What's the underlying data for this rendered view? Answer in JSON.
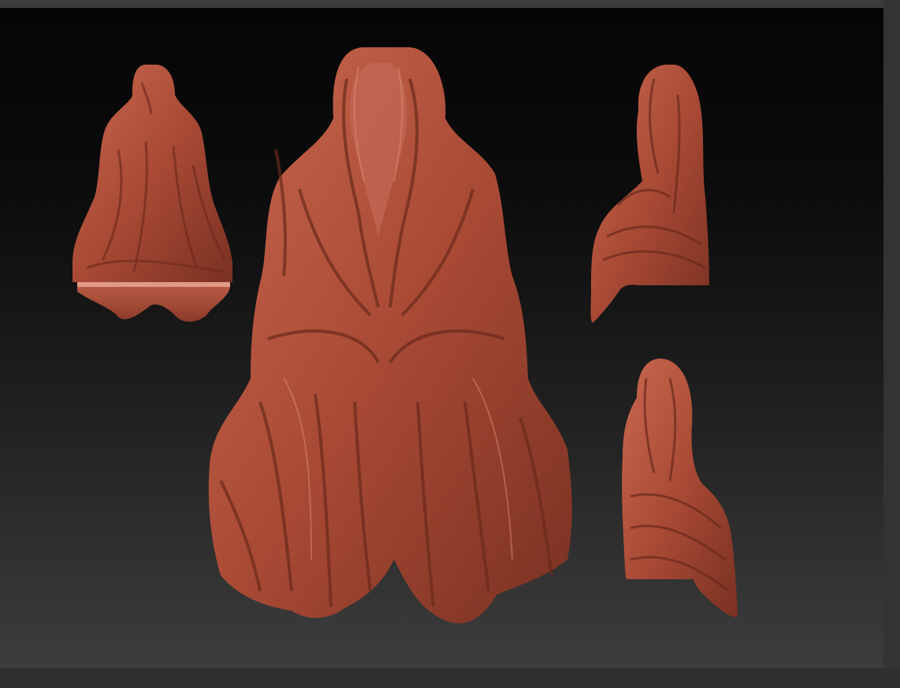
{
  "app": {
    "name": ""
  },
  "scene": {
    "background_top": "#050505",
    "background_bottom": "#3d3d3d",
    "frame_color": "#383838",
    "material_color": "#b2533f",
    "material_shadow": "#6e2a1d",
    "material_highlight": "#d98a72",
    "views": [
      {
        "id": "back",
        "label": ""
      },
      {
        "id": "front",
        "label": ""
      },
      {
        "id": "side",
        "label": ""
      },
      {
        "id": "three-quarter",
        "label": ""
      }
    ]
  }
}
